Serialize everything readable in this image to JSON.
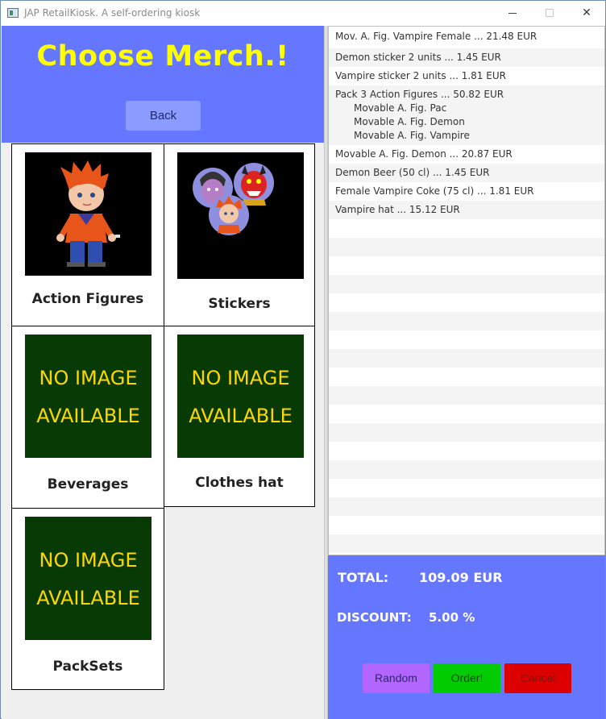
{
  "window": {
    "title": "JAP RetailKiosk. A self-ordering kiosk"
  },
  "left": {
    "heading": "Choose Merch.!",
    "back_label": "Back",
    "no_image_line1": "NO IMAGE",
    "no_image_line2": "AVAILABLE",
    "categories": [
      {
        "label": "Action Figures",
        "image": "action-figure-picture"
      },
      {
        "label": "Stickers",
        "image": "stickers-picture"
      },
      {
        "label": "Beverages",
        "image": "no-image-placeholder"
      },
      {
        "label": "Clothes hat",
        "image": "no-image-placeholder"
      },
      {
        "label": "PackSets",
        "image": "no-image-placeholder"
      }
    ]
  },
  "order": {
    "items": [
      {
        "text": "Mov. A. Fig. Vampire Female ... 21.48 EUR",
        "sub": []
      },
      {
        "text": "Demon sticker 2 units ... 1.45 EUR",
        "sub": []
      },
      {
        "text": "Vampire sticker 2 units ... 1.81 EUR",
        "sub": []
      },
      {
        "text": "Pack 3 Action Figures ... 50.82 EUR",
        "sub": [
          "Movable A. Fig. Pac",
          "Movable A. Fig. Demon",
          "Movable A. Fig. Vampire"
        ]
      },
      {
        "text": "Movable A. Fig. Demon ... 20.87 EUR",
        "sub": []
      },
      {
        "text": "Demon Beer (50 cl) ... 1.45 EUR",
        "sub": []
      },
      {
        "text": "Female Vampire Coke (75 cl) ... 1.81 EUR",
        "sub": []
      },
      {
        "text": "Vampire hat ... 15.12 EUR",
        "sub": []
      }
    ]
  },
  "summary": {
    "total_label": "TOTAL:",
    "total_value": "109.09 EUR",
    "discount_label": "DISCOUNT:",
    "discount_value": "5.00 %"
  },
  "buttons": {
    "random": "Random",
    "order": "Order!",
    "cancel": "Cancel"
  },
  "colors": {
    "panel_blue": "#6677ff",
    "heading_yellow": "#ffff00",
    "random_purple": "#b266ff",
    "order_green": "#00cc00",
    "cancel_red": "#dd0000",
    "no_image_bg": "#073a04",
    "no_image_text": "#ffd700"
  }
}
